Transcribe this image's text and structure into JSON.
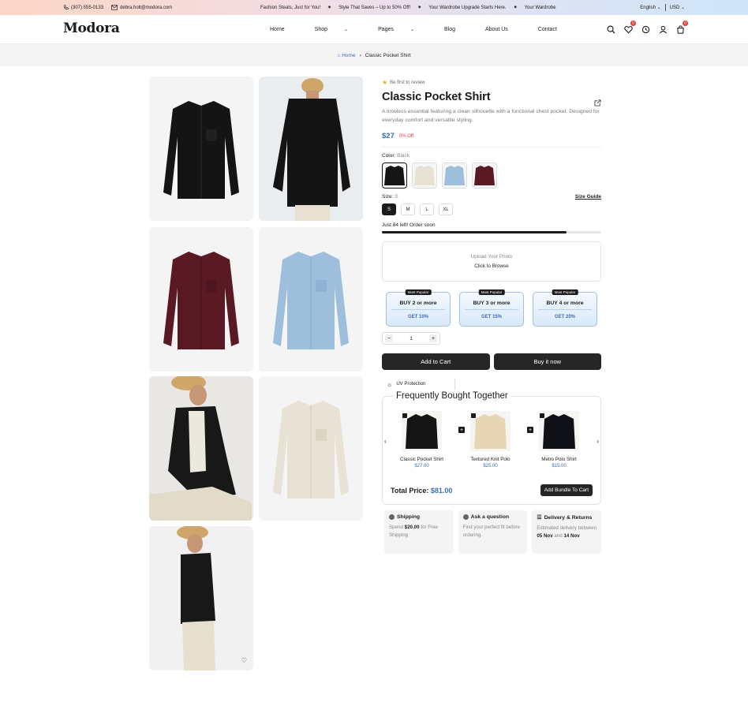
{
  "topbar": {
    "phone": "(307) 555-0133",
    "email": "debra.holt@modora.com",
    "announcements": [
      "Fashion Steals, Just for You!",
      "Style That Saves – Up to 50% Off!",
      "Your Wardrobe Upgrade Starts Here.",
      "Your Wardrobe"
    ],
    "language": "English",
    "currency": "USD"
  },
  "header": {
    "logo": "Modora",
    "nav": [
      "Home",
      "Shop",
      "Pages",
      "Blog",
      "About Us",
      "Contact"
    ],
    "wishlist_count": "0",
    "cart_count": "0"
  },
  "breadcrumb": {
    "home": "Home",
    "current": "Classic Pocket Shirt"
  },
  "product": {
    "review": "Be first to review",
    "title": "Classic Pocket Shirt",
    "description": "A timeless essential featuring a clean silhouette with a functional chest pocket. Designed for everyday comfort and versatile styling.",
    "price": "$27",
    "discount": "0% Off",
    "color_label": "Color:",
    "color_value": "Black",
    "colors": [
      "#151515",
      "#e8e2d4",
      "#9dbfdc",
      "#5a1a24"
    ],
    "size_label": "Size:",
    "size_value": "S",
    "sizes": [
      "S",
      "M",
      "L",
      "XL"
    ],
    "size_guide": "Size Guide",
    "stock_text": "Just 84 left! Order soon",
    "stock_fraction": 0.84,
    "upload_title": "Upload Your Photo",
    "upload_action": "Click to Browse",
    "bundles": [
      {
        "tag": "Most Popular",
        "title": "BUY 2 or more",
        "discount": "GET 10%"
      },
      {
        "tag": "Most Popular",
        "title": "BUY 3 or more",
        "discount": "GET 15%"
      },
      {
        "tag": "Most Popular",
        "title": "BUY 4 or more",
        "discount": "GET 20%"
      }
    ],
    "quantity": "1",
    "add_to_cart": "Add to Cart",
    "buy_now": "Buy it now",
    "uv": "UV Protection"
  },
  "fbt": {
    "title": "Frequently Bought Together",
    "items": [
      {
        "name": "Classic Pocket Shirt",
        "price": "$27.00",
        "color": "#151515"
      },
      {
        "name": "Textured Knit Polo",
        "price": "$25.00",
        "color": "#e6d6b6"
      },
      {
        "name": "Metro Polo Shirt",
        "price": "$15.00",
        "color": "#101218"
      }
    ],
    "total_label": "Total Price:",
    "total": "$81.00",
    "add_bundle": "Add Bundle To Cart"
  },
  "cards": {
    "shipping_title": "Shipping",
    "shipping_pre": "Spend",
    "shipping_amount": "$20.00",
    "shipping_post": "for Free Shipping",
    "ask_title": "Ask a question",
    "ask_body": "Find your perfect fit before ordering.",
    "delivery_title": "Delivery & Returns",
    "delivery_pre": "Estimated delivery between",
    "delivery_from": "05 Nov",
    "delivery_and": "and",
    "delivery_to": "14 Nov"
  }
}
